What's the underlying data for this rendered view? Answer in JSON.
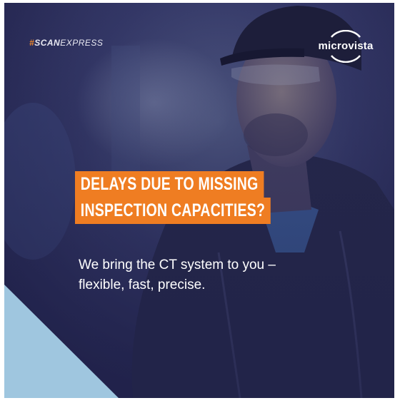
{
  "hashtag": {
    "symbol": "#",
    "bold": "SCAN",
    "rest": "EXPRESS"
  },
  "logo": {
    "text": "microvista"
  },
  "headline": {
    "line1": "DELAYS DUE TO MISSING",
    "line2": "INSPECTION CAPACITIES?"
  },
  "subtext": {
    "line1": "We bring the CT system to you –",
    "line2": "flexible, fast, precise."
  },
  "colors": {
    "accent_orange": "#ef7d22",
    "overlay_navy": "#2a2b58",
    "corner_blue": "#9fc6df"
  }
}
